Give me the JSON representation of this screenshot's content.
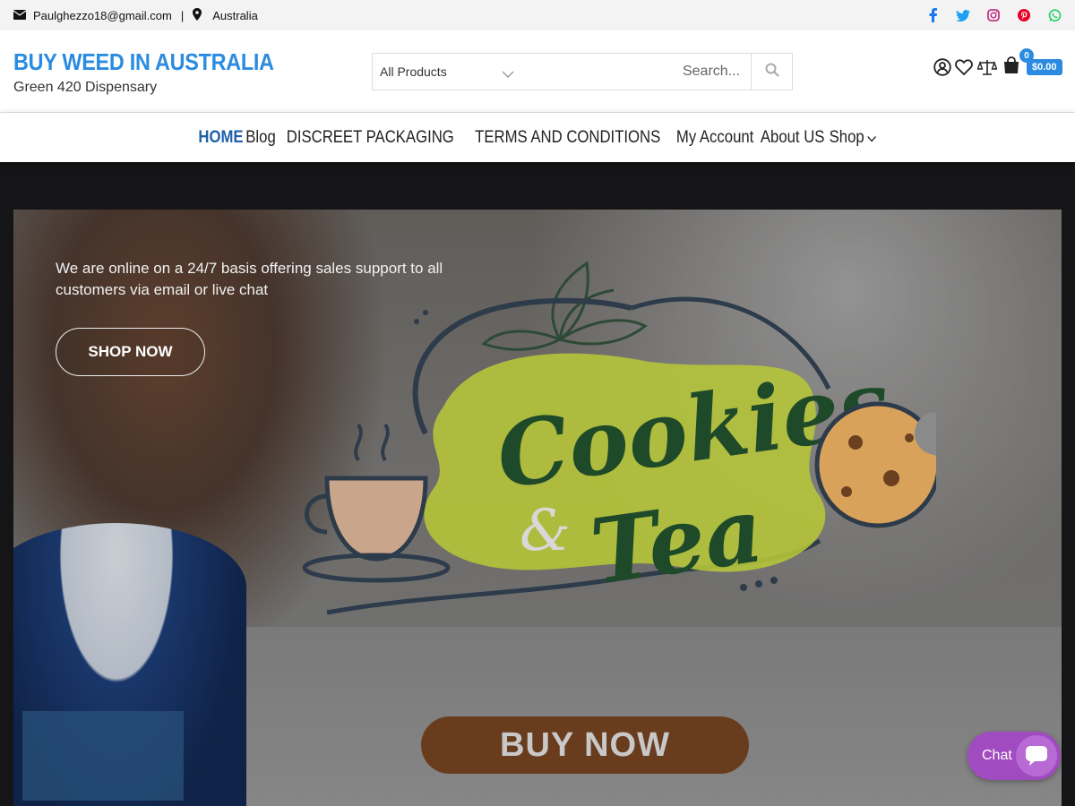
{
  "topbar": {
    "email": "Paulghezzo18@gmail.com",
    "separator": "|",
    "location": "Australia"
  },
  "social": [
    "facebook-icon",
    "twitter-icon",
    "instagram-icon",
    "pinterest-icon",
    "whatsapp-icon"
  ],
  "brand": {
    "title": "BUY WEED IN AUSTRALIA",
    "subtitle": "Green 420 Dispensary"
  },
  "search": {
    "category": "All Products",
    "placeholder": "Search..."
  },
  "cart": {
    "count": "0",
    "total": "$0.00"
  },
  "nav": {
    "items": [
      "HOME",
      "Blog",
      "DISCREET PACKAGING",
      "TERMS AND CONDITIONS",
      "My Account",
      "About US",
      "Shop"
    ]
  },
  "hero": {
    "message": "We are online on a 24/7 basis offering sales support to all customers via email or live chat",
    "cta_label": "SHOP NOW",
    "logo_line1": "Cookies",
    "logo_amp": "&",
    "logo_line2": "Tea",
    "buy_label": "BUY NOW"
  },
  "chat": {
    "label": "Chat"
  },
  "colors": {
    "accent": "#2a8be0",
    "nav_active": "#1f5fa8",
    "chat": "#a14bc0"
  }
}
